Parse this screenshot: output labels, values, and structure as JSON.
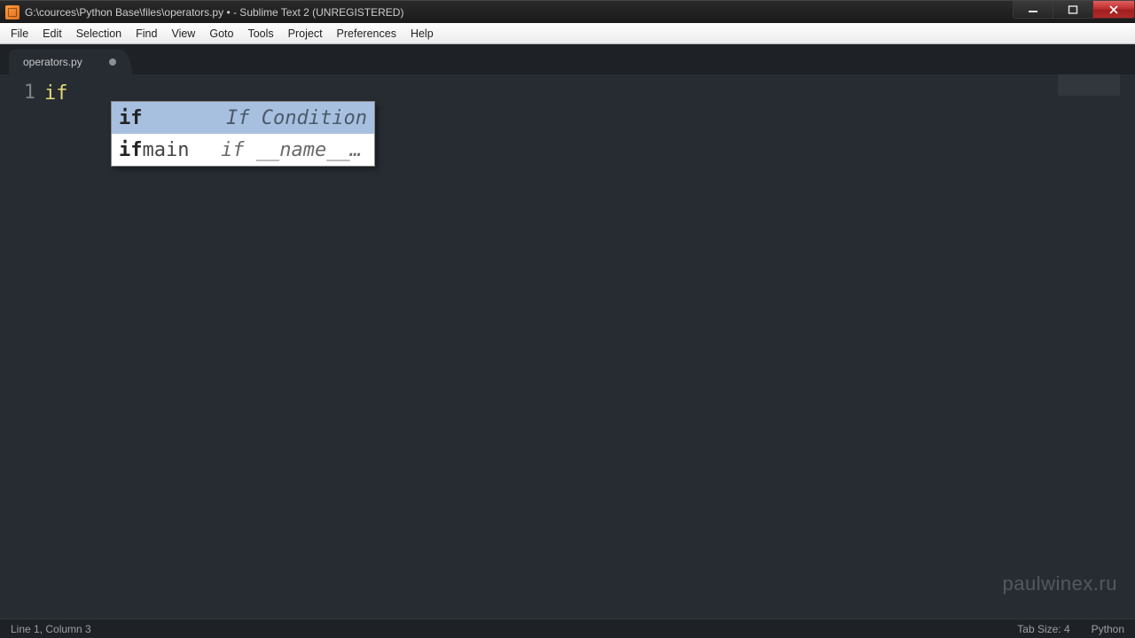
{
  "window": {
    "title": "G:\\cources\\Python Base\\files\\operators.py • - Sublime Text 2 (UNREGISTERED)"
  },
  "menu": {
    "items": [
      "File",
      "Edit",
      "Selection",
      "Find",
      "View",
      "Goto",
      "Tools",
      "Project",
      "Preferences",
      "Help"
    ]
  },
  "tabs": [
    {
      "label": "operators.py",
      "dirty": true
    }
  ],
  "editor": {
    "gutter": [
      "1"
    ],
    "code_line1_keyword": "if"
  },
  "autocomplete": {
    "items": [
      {
        "trigger_bold": "if",
        "trigger_rest": "",
        "description": "If Condition",
        "selected": true
      },
      {
        "trigger_bold": "if",
        "trigger_rest": "main",
        "description": "if __name__ …",
        "selected": false
      }
    ]
  },
  "status": {
    "left": "Line 1, Column 3",
    "tab_size": "Tab Size: 4",
    "syntax": "Python"
  },
  "watermark": "paulwinex.ru"
}
